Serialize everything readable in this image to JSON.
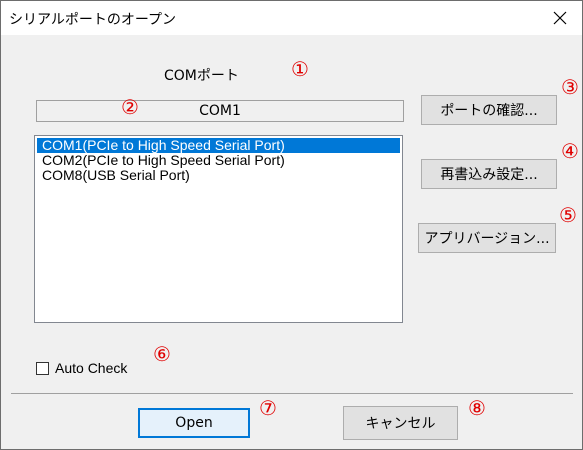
{
  "window": {
    "title": "シリアルポートのオープン"
  },
  "icons": {
    "close": "close-icon"
  },
  "com_section": {
    "label": "COMポート",
    "port_value": "COM1"
  },
  "ports_list": [
    "COM1(PCIe to High Speed Serial Port)",
    "COM2(PCIe to High Speed Serial Port)",
    "COM8(USB Serial Port)"
  ],
  "selected_index": 0,
  "buttons": {
    "check_port": "ポートの確認...",
    "rewrite_settings": "再書込み設定...",
    "app_version": "アプリバージョン...",
    "open": "Open",
    "cancel": "キャンセル"
  },
  "auto_check": {
    "label": "Auto Check",
    "checked": false
  },
  "annotations": [
    "①",
    "②",
    "③",
    "④",
    "⑤",
    "⑥",
    "⑦",
    "⑧"
  ],
  "colors": {
    "annotation": "#e00000",
    "selection": "#0078d7",
    "dialog_bg": "#f0f0f0"
  }
}
